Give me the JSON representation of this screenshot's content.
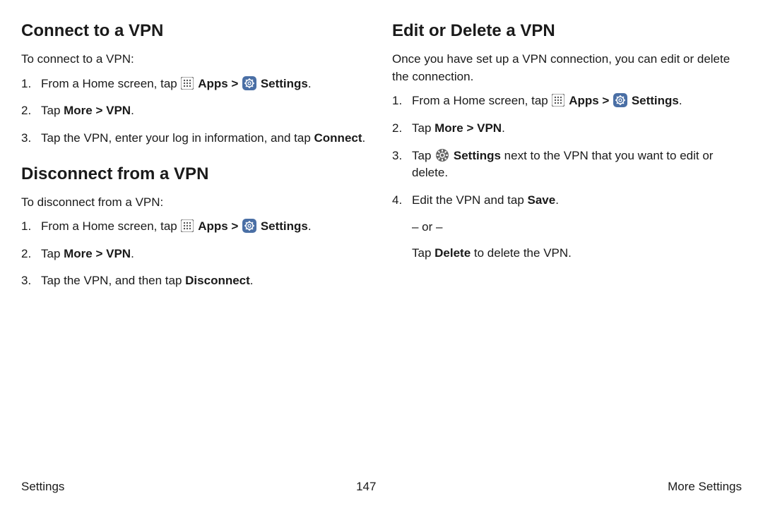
{
  "leftColumn": {
    "section1": {
      "heading": "Connect to a VPN",
      "intro": "To connect to a VPN:",
      "step1_a": "From a Home screen, tap ",
      "step1_apps": "Apps",
      "step1_gt": " > ",
      "step1_settings": "Settings",
      "step1_end": ".",
      "step2_a": "Tap ",
      "step2_b": "More > VPN",
      "step2_c": ".",
      "step3_a": "Tap the VPN, enter your log in information, and tap ",
      "step3_b": "Connect",
      "step3_c": "."
    },
    "section2": {
      "heading": "Disconnect from a VPN",
      "intro": "To disconnect from a VPN:",
      "step1_a": "From a Home screen, tap ",
      "step1_apps": "Apps",
      "step1_gt": " > ",
      "step1_settings": "Settings",
      "step1_end": ".",
      "step2_a": "Tap ",
      "step2_b": "More > VPN",
      "step2_c": ".",
      "step3_a": "Tap the VPN, and then tap ",
      "step3_b": "Disconnect",
      "step3_c": "."
    }
  },
  "rightColumn": {
    "section1": {
      "heading": "Edit or Delete a VPN",
      "intro": "Once you have set up a VPN connection, you can edit or delete the connection.",
      "step1_a": "From a Home screen, tap ",
      "step1_apps": "Apps",
      "step1_gt": " > ",
      "step1_settings": "Settings",
      "step1_end": ".",
      "step2_a": "Tap ",
      "step2_b": "More > VPN",
      "step2_c": ".",
      "step3_a": "Tap ",
      "step3_b": "Settings",
      "step3_c": " next to the VPN that you want to edit or delete.",
      "step4_a": "Edit the VPN and tap ",
      "step4_b": "Save",
      "step4_c": ".",
      "or": "– or –",
      "tail_a": "Tap ",
      "tail_b": "Delete",
      "tail_c": " to delete the VPN."
    }
  },
  "footer": {
    "left": "Settings",
    "center": "147",
    "right": "More Settings"
  }
}
